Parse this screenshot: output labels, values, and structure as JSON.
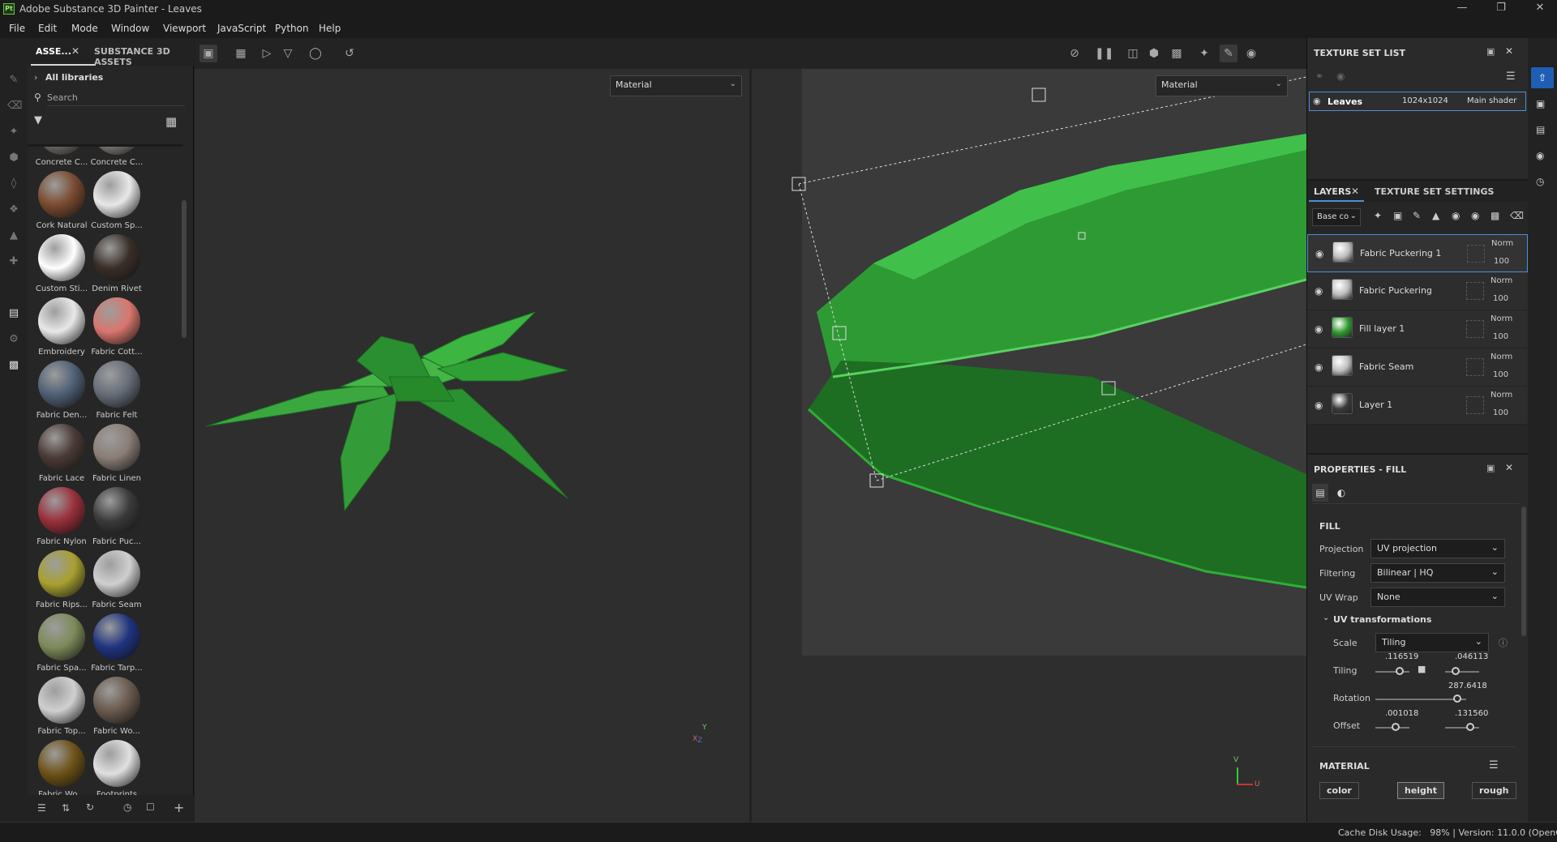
{
  "window": {
    "title": "Adobe Substance 3D Painter - Leaves",
    "logo": "Pt"
  },
  "menu": [
    "File",
    "Edit",
    "Mode",
    "Window",
    "Viewport",
    "JavaScript",
    "Python",
    "Help"
  ],
  "assets": {
    "tab_active": "ASSE...",
    "tab_other": "SUBSTANCE 3D ASSETS",
    "library": "All libraries",
    "search_placeholder": "Search",
    "items": [
      {
        "label": "Concrete C...",
        "color": "#7a7470"
      },
      {
        "label": "Concrete C...",
        "color": "#8a8580"
      },
      {
        "label": "Cork Natural",
        "color": "#7a4a30"
      },
      {
        "label": "Custom Sp...",
        "color": "#e8e8e8"
      },
      {
        "label": "Custom Sti...",
        "color": "#ffffff"
      },
      {
        "label": "Denim Rivet",
        "color": "#3a2f28"
      },
      {
        "label": "Embroidery",
        "color": "#e8e8e8"
      },
      {
        "label": "Fabric Cott...",
        "color": "#d9766e"
      },
      {
        "label": "Fabric Den...",
        "color": "#4f5f75"
      },
      {
        "label": "Fabric Felt",
        "color": "#666d78"
      },
      {
        "label": "Fabric Lace",
        "color": "#4a3a36"
      },
      {
        "label": "Fabric Linen",
        "color": "#8a7e76"
      },
      {
        "label": "Fabric Nylon",
        "color": "#9a2f3a"
      },
      {
        "label": "Fabric Puc...",
        "color": "#3a3a3a"
      },
      {
        "label": "Fabric Rips...",
        "color": "#a8a030"
      },
      {
        "label": "Fabric Seam",
        "color": "#cfcfcf"
      },
      {
        "label": "Fabric Spa...",
        "color": "#7d8a5a"
      },
      {
        "label": "Fabric Tarp...",
        "color": "#1f3380"
      },
      {
        "label": "Fabric Top...",
        "color": "#d0d0d0"
      },
      {
        "label": "Fabric Wo...",
        "color": "#6a5a4e"
      },
      {
        "label": "Fabric Wo...",
        "color": "#6e5218"
      },
      {
        "label": "Footprints",
        "color": "#e0e0e0"
      }
    ]
  },
  "viewport": {
    "left_mode": "Material",
    "right_mode": "Material",
    "axis_labels": {
      "y": "Y",
      "x": "X",
      "z": "Z",
      "v": "V",
      "u": "U"
    }
  },
  "texture_set_list": {
    "title": "TEXTURE SET LIST",
    "set": {
      "name": "Leaves",
      "resolution": "1024x1024",
      "shader": "Main shader"
    }
  },
  "layers": {
    "tab_active": "LAYERS",
    "tab_other": "TEXTURE SET SETTINGS",
    "channel": "Base co",
    "items": [
      {
        "name": "Fabric Puckering 1",
        "blend": "Norm",
        "opacity": "100",
        "thumb": "#bdbdbd"
      },
      {
        "name": "Fabric Puckering",
        "blend": "Norm",
        "opacity": "100",
        "thumb": "#bdbdbd"
      },
      {
        "name": "Fill layer 1",
        "blend": "Norm",
        "opacity": "100",
        "thumb": "#2e9a2e"
      },
      {
        "name": "Fabric Seam",
        "blend": "Norm",
        "opacity": "100",
        "thumb": "#bdbdbd"
      },
      {
        "name": "Layer 1",
        "blend": "Norm",
        "opacity": "100",
        "thumb": "#3a3a3a"
      }
    ]
  },
  "properties": {
    "title": "PROPERTIES - FILL",
    "section": "FILL",
    "projection_label": "Projection",
    "projection": "UV projection",
    "filtering_label": "Filtering",
    "filtering": "Bilinear | HQ",
    "uvwrap_label": "UV Wrap",
    "uvwrap": "None",
    "uv_section": "UV transformations",
    "scale_label": "Scale",
    "scale": "Tiling",
    "tiling_label": "Tiling",
    "tiling_u": ".116519",
    "tiling_v": ".046113",
    "rotation_label": "Rotation",
    "rotation": "287.6418",
    "offset_label": "Offset",
    "offset_u": ".001018",
    "offset_v": ".131560",
    "material_section": "MATERIAL",
    "channels": [
      "color",
      "height",
      "rough"
    ]
  },
  "status": {
    "text": "Cache Disk Usage:   98% | Version: 11.0.0 (OpenGL)"
  }
}
